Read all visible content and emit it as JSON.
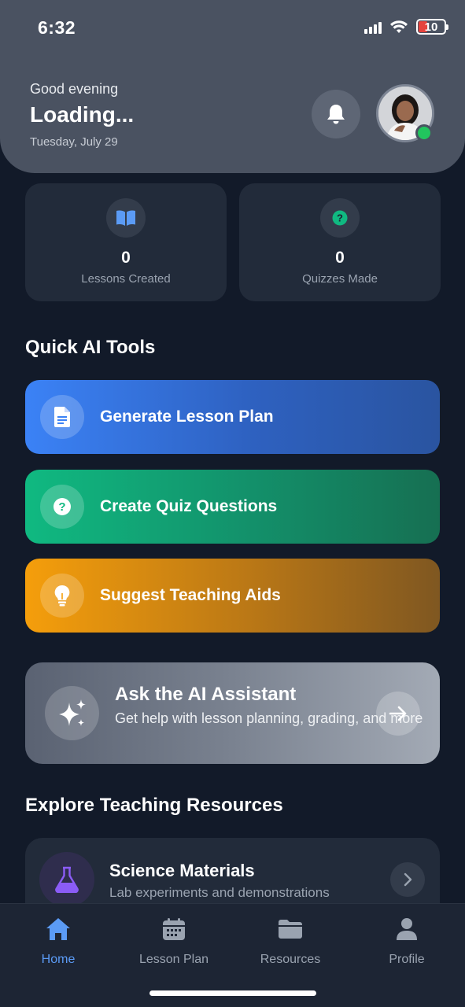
{
  "status_bar": {
    "time": "6:32",
    "battery": "10"
  },
  "header": {
    "greeting": "Good evening",
    "user_name": "Loading...",
    "date": "Tuesday, July 29"
  },
  "stats": [
    {
      "value": "0",
      "label": "Lessons Created",
      "icon": "book-icon",
      "icon_color": "#5b9bf5"
    },
    {
      "value": "0",
      "label": "Quizzes Made",
      "icon": "question-circle-icon",
      "icon_color": "#10b981"
    }
  ],
  "quick_tools": {
    "title": "Quick AI Tools",
    "items": [
      {
        "label": "Generate Lesson Plan",
        "icon": "document-icon",
        "color": "#3b82f6"
      },
      {
        "label": "Create Quiz Questions",
        "icon": "question-circle-icon",
        "color": "#10b981"
      },
      {
        "label": "Suggest Teaching Aids",
        "icon": "lightbulb-icon",
        "color": "#f59e0b"
      }
    ]
  },
  "assistant": {
    "title": "Ask the AI Assistant",
    "subtitle": "Get help with lesson planning, grading, and more"
  },
  "resources": {
    "title": "Explore Teaching Resources",
    "items": [
      {
        "title": "Science Materials",
        "subtitle": "Lab experiments and demonstrations",
        "icon": "flask-icon",
        "color": "#8b5cf6"
      }
    ]
  },
  "tabbar": {
    "items": [
      {
        "label": "Home",
        "icon": "home-icon",
        "active": true
      },
      {
        "label": "Lesson Plan",
        "icon": "calendar-icon",
        "active": false
      },
      {
        "label": "Resources",
        "icon": "folder-icon",
        "active": false
      },
      {
        "label": "Profile",
        "icon": "user-icon",
        "active": false
      }
    ],
    "active_color": "#5b9bf5"
  }
}
